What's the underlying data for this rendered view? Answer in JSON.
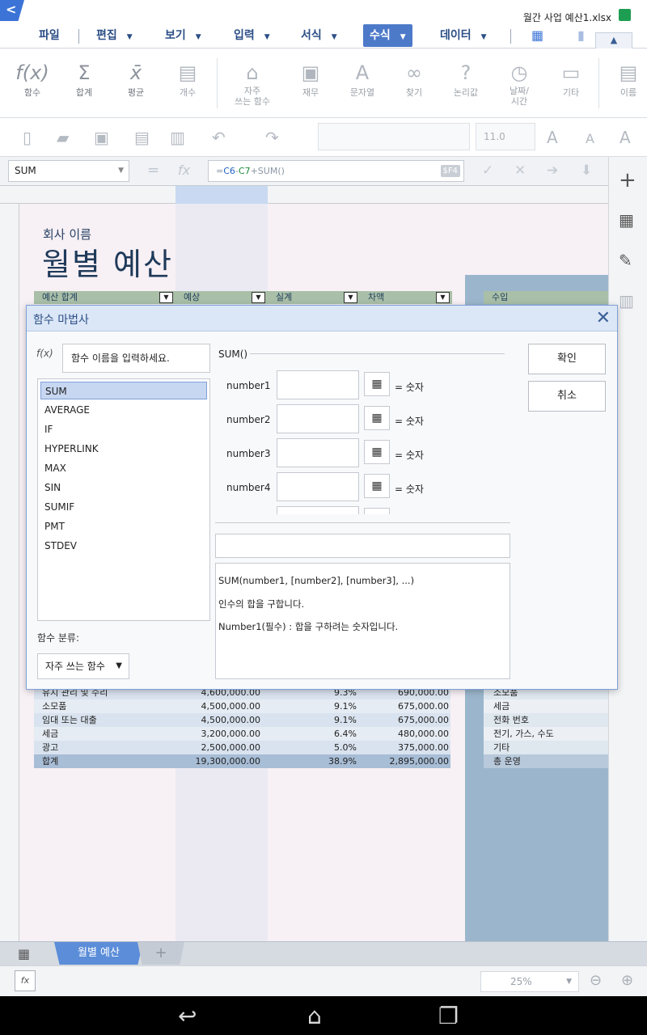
{
  "app": {
    "doc_title": "월간 사업 예산1.xlsx",
    "back_label": "<"
  },
  "menu": [
    {
      "label": "파일"
    },
    {
      "label": "편집"
    },
    {
      "label": "보기"
    },
    {
      "label": "입력"
    },
    {
      "label": "서식"
    },
    {
      "label": "수식"
    },
    {
      "label": "데이터"
    }
  ],
  "ribbon": [
    {
      "label": "함수",
      "icon": "function-icon"
    },
    {
      "label": "합계",
      "icon": "sigma-icon"
    },
    {
      "label": "평균",
      "icon": "average-icon"
    },
    {
      "label": "개수",
      "icon": "count-icon"
    },
    {
      "label": "자주\n쓰는 함수",
      "icon": "frequent-functions-icon"
    },
    {
      "label": "재무",
      "icon": "financial-icon"
    },
    {
      "label": "문자열",
      "icon": "text-icon"
    },
    {
      "label": "찾기",
      "icon": "lookup-icon"
    },
    {
      "label": "논리값",
      "icon": "logical-icon"
    },
    {
      "label": "날짜/\n시간",
      "icon": "datetime-icon"
    },
    {
      "label": "기타",
      "icon": "other-icon"
    },
    {
      "label": "이름",
      "icon": "name-icon"
    }
  ],
  "format_toolbar": {
    "font_size": "11.0"
  },
  "formula_bar": {
    "name_box": "SUM",
    "formula_c6": "C6",
    "formula_dash": "-",
    "formula_c7": "C7",
    "formula_rest": "+SUM()",
    "f4_badge": "$F4"
  },
  "sheet": {
    "company_name": "회사 이름",
    "title": "월별 예산",
    "headers": [
      "예산 합계",
      "예상",
      "실계",
      "차액"
    ],
    "right_header": "수입",
    "rows": [
      {
        "name": "유지 관리 및 수리",
        "budget": "4,600,000.00",
        "pct": "9.3%",
        "diff": "690,000.00"
      },
      {
        "name": "소모품",
        "budget": "4,500,000.00",
        "pct": "9.1%",
        "diff": "675,000.00"
      },
      {
        "name": "임대 또는 대출",
        "budget": "4,500,000.00",
        "pct": "9.1%",
        "diff": "675,000.00"
      },
      {
        "name": "세금",
        "budget": "3,200,000.00",
        "pct": "6.4%",
        "diff": "480,000.00"
      },
      {
        "name": "광고",
        "budget": "2,500,000.00",
        "pct": "5.0%",
        "diff": "375,000.00"
      },
      {
        "name": "합계",
        "budget": "19,300,000.00",
        "pct": "38.9%",
        "diff": "2,895,000.00"
      }
    ],
    "right_rows": [
      "소모품",
      "세금",
      "전화 번호",
      "전기, 가스, 수도",
      "기타",
      "총 운영"
    ],
    "tab_name": "월별 예산",
    "add_tab": "+"
  },
  "status": {
    "zoom": "25%"
  },
  "dialog": {
    "title": "함수 마법사",
    "search_placeholder": "함수 이름을 입력하세요.",
    "functions": [
      "SUM",
      "AVERAGE",
      "IF",
      "HYPERLINK",
      "MAX",
      "SIN",
      "SUMIF",
      "PMT",
      "STDEV"
    ],
    "category_label": "함수 분류:",
    "category_value": "자주 쓰는 함수",
    "signature": "SUM()",
    "args": [
      {
        "name": "number1",
        "type": "= 숫자"
      },
      {
        "name": "number2",
        "type": "= 숫자"
      },
      {
        "name": "number3",
        "type": "= 숫자"
      },
      {
        "name": "number4",
        "type": "= 숫자"
      }
    ],
    "description": {
      "syntax": "SUM(number1, [number2], [number3], ...)",
      "summary": "인수의 합을 구합니다.",
      "arg_help": "Number1(필수) : 합을 구하려는 숫자입니다."
    },
    "ok_label": "확인",
    "cancel_label": "취소"
  }
}
